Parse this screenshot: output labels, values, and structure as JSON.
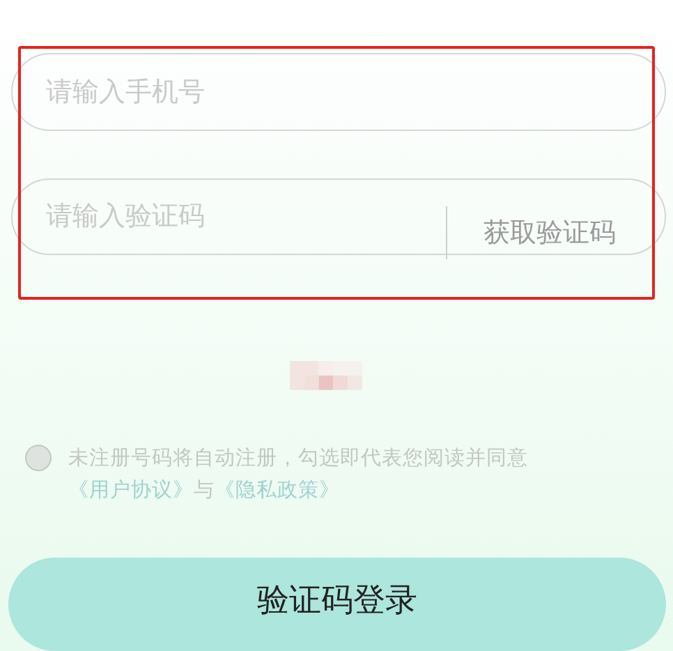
{
  "phone_field": {
    "placeholder": "请输入手机号"
  },
  "code_field": {
    "placeholder": "请输入验证码",
    "button": "获取验证码"
  },
  "agreement": {
    "checked": false,
    "parts": [
      {
        "kind": "text",
        "text": "未注册号码将自动注册，勾选即代表您阅读并同意"
      },
      {
        "kind": "link",
        "text": "《用户协议》"
      },
      {
        "kind": "text",
        "text": "与"
      },
      {
        "kind": "link",
        "text": "《隐私政策》"
      }
    ]
  },
  "login_button": "验证码登录"
}
